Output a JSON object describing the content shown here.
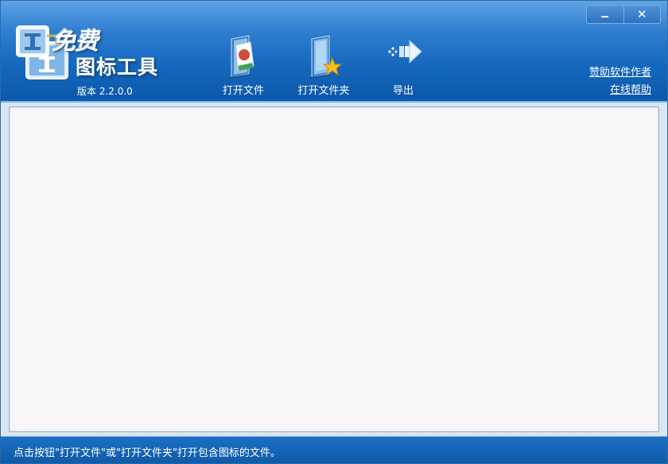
{
  "window": {
    "controls": {
      "minimize_icon": "minimize-icon",
      "close_symbol": "✕"
    }
  },
  "logo": {
    "free_text": "免费",
    "name": "图标工具",
    "version": "版本 2.2.0.0"
  },
  "toolbar": {
    "open_file_label": "打开文件",
    "open_folder_label": "打开文件夹",
    "export_label": "导出"
  },
  "links": {
    "sponsor_label": "赞助软件作者",
    "help_label": "在线帮助"
  },
  "status": {
    "text": "点击按钮\"打开文件\"或\"打开文件夹\"打开包含图标的文件。"
  },
  "colors": {
    "header_top": "#5fa3e4",
    "header_bottom": "#0c57a8",
    "panel_background": "#f7f7fa",
    "statusbar": "#1467be"
  }
}
